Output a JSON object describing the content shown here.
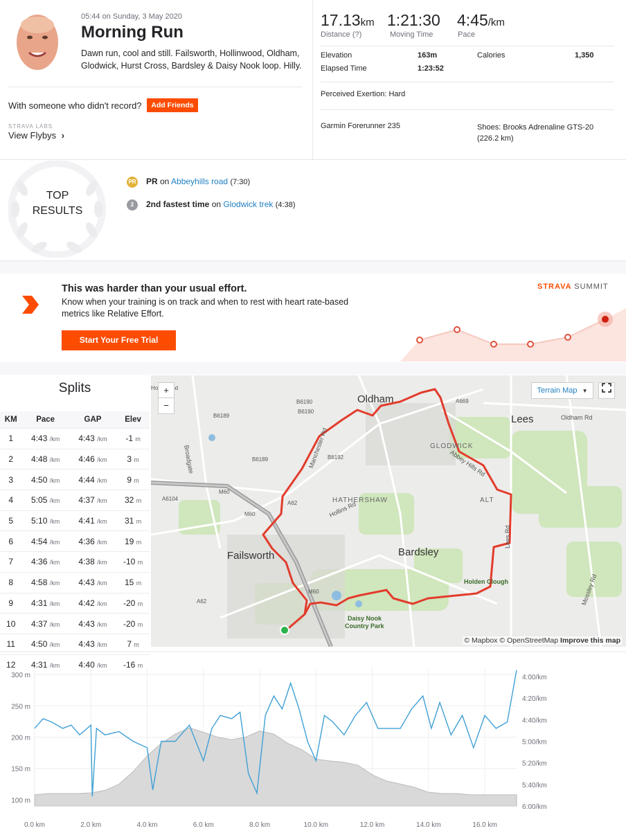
{
  "activity": {
    "datetime": "05:44 on Sunday, 3 May 2020",
    "title": "Morning Run",
    "description": "Dawn run, cool and still. Failsworth, Hollinwood, Oldham, Glodwick, Hurst Cross, Bardsley & Daisy Nook loop. Hilly."
  },
  "social": {
    "with_text": "With someone who didn't record?",
    "add_friends": "Add Friends",
    "labs": "STRAVA LABS",
    "flybys": "View Flybys"
  },
  "stats": {
    "distance": {
      "value": "17.13",
      "unit": "km",
      "label": "Distance (?)"
    },
    "moving_time": {
      "value": "1:21:30",
      "label": "Moving Time"
    },
    "pace": {
      "value": "4:45",
      "unit": "/km",
      "label": "Pace"
    },
    "elevation": {
      "label": "Elevation",
      "value": "163m"
    },
    "calories": {
      "label": "Calories",
      "value": "1,350"
    },
    "elapsed": {
      "label": "Elapsed Time",
      "value": "1:23:52"
    },
    "exertion_label": "Perceived Exertion:",
    "exertion_value": "Hard",
    "device": "Garmin Forerunner 235",
    "shoes": "Shoes: Brooks Adrenaline GTS-20 (226.2 km)"
  },
  "top_results": {
    "label_line1": "TOP",
    "label_line2": "RESULTS",
    "items": [
      {
        "badge": "PR",
        "bold": "PR",
        "mid": " on ",
        "segment": "Abbeyhills road",
        "time": "(7:30)"
      },
      {
        "badge": "2",
        "bold": "2nd fastest time",
        "mid": " on ",
        "segment": "Glodwick trek",
        "time": "(4:38)"
      }
    ]
  },
  "summit": {
    "heading": "This was harder than your usual effort.",
    "body": "Know when your training is on track and when to rest with heart rate-based metrics like Relative Effort.",
    "button": "Start Your Free Trial",
    "logo_strava": "STRAVA",
    "logo_summit": "SUMMIT"
  },
  "splits": {
    "title": "Splits",
    "headers": [
      "KM",
      "Pace",
      "GAP",
      "Elev"
    ],
    "pace_unit": "/km",
    "elev_unit": "m",
    "rows": [
      [
        "1",
        "4:43",
        "4:43",
        "-1"
      ],
      [
        "2",
        "4:48",
        "4:46",
        "3"
      ],
      [
        "3",
        "4:50",
        "4:44",
        "9"
      ],
      [
        "4",
        "5:05",
        "4:37",
        "32"
      ],
      [
        "5",
        "5:10",
        "4:41",
        "31"
      ],
      [
        "6",
        "4:54",
        "4:36",
        "19"
      ],
      [
        "7",
        "4:36",
        "4:38",
        "-10"
      ],
      [
        "8",
        "4:58",
        "4:43",
        "15"
      ],
      [
        "9",
        "4:31",
        "4:42",
        "-20"
      ],
      [
        "10",
        "4:37",
        "4:43",
        "-20"
      ],
      [
        "11",
        "4:50",
        "4:43",
        "7"
      ],
      [
        "12",
        "4:31",
        "4:40",
        "-16"
      ]
    ]
  },
  "map": {
    "type_label": "Terrain Map",
    "zoom_in": "+",
    "zoom_out": "−",
    "attribution": "© Mapbox © OpenStreetMap",
    "improve": "Improve this map",
    "places": {
      "oldham": "Oldham",
      "lees": "Lees",
      "failsworth": "Failsworth",
      "bardsley": "Bardsley",
      "hathershaw": "HATHERSHAW",
      "glodwick": "GLODWICK",
      "alt": "ALT",
      "holden": "Holden Clough",
      "daisy1": "Daisy Nook",
      "daisy2": "Country Park",
      "road_b6190": "B6190",
      "road_b6190b": "B6190",
      "road_b6189": "B6189",
      "road_b6189b": "B6189",
      "road_b6192": "B6192",
      "road_a669": "A669",
      "road_a6104": "A6104",
      "road_m60": "M60",
      "road_m60b": "M60",
      "road_m60c": "M60",
      "road_a62": "A62",
      "road_a62b": "A62",
      "road_manchester": "Manchester Rd",
      "road_hollins": "Hollins Rd",
      "road_abbey": "Abbey Hills Rd",
      "road_lees": "Lees Rd",
      "road_oldham": "Oldham Rd",
      "road_mossley": "Mossley Rd",
      "road_broadgate": "Broadgate",
      "road_hollinwood": "Hollinwood"
    }
  },
  "chart_data": {
    "type": "line",
    "x_label_ticks": [
      "0.0 km",
      "2.0 km",
      "4.0 km",
      "6.0 km",
      "8.0 km",
      "10.0 km",
      "12.0 km",
      "14.0 km",
      "16.0 km"
    ],
    "xlim": [
      0,
      17.13
    ],
    "left_axis": {
      "ticks": [
        "100 m",
        "150 m",
        "200 m",
        "250 m",
        "300 m"
      ],
      "ylim": [
        90,
        310
      ]
    },
    "right_axis": {
      "ticks": [
        "4:00/km",
        "4:20/km",
        "4:40/km",
        "5:00/km",
        "5:20/km",
        "5:40/km",
        "6:00/km"
      ],
      "ylim_min_per_km": [
        4.0,
        6.0
      ]
    },
    "series": [
      {
        "kind": "elevation",
        "color": "#c8c8c8",
        "x": [
          0,
          0.5,
          1,
          1.5,
          2,
          2.5,
          3,
          3.5,
          4,
          4.5,
          5,
          5.5,
          6,
          6.5,
          7,
          7.5,
          8,
          8.5,
          9,
          9.5,
          10,
          10.5,
          11,
          11.5,
          12,
          12.5,
          13,
          13.5,
          14,
          14.5,
          15,
          15.5,
          16,
          16.5,
          17.13
        ],
        "values": [
          108,
          110,
          110,
          110,
          111,
          115,
          125,
          145,
          170,
          190,
          205,
          215,
          208,
          200,
          196,
          200,
          210,
          205,
          190,
          180,
          165,
          162,
          160,
          155,
          140,
          130,
          125,
          120,
          112,
          110,
          110,
          108,
          108,
          108,
          108
        ]
      },
      {
        "kind": "pace",
        "color": "#3fa0d6",
        "x": [
          0,
          0.3,
          0.6,
          1,
          1.3,
          1.6,
          2,
          2.05,
          2.2,
          2.5,
          3,
          3.5,
          4,
          4.2,
          4.5,
          5,
          5.5,
          6,
          6.3,
          6.6,
          7,
          7.3,
          7.6,
          7.9,
          8.2,
          8.5,
          8.8,
          9.1,
          9.4,
          9.7,
          10,
          10.3,
          10.6,
          11,
          11.4,
          11.8,
          12.2,
          12.6,
          13,
          13.4,
          13.8,
          14.1,
          14.4,
          14.8,
          15.2,
          15.6,
          16,
          16.4,
          16.8,
          17.13
        ],
        "values_min_per_km": [
          4.8,
          4.65,
          4.7,
          4.8,
          4.75,
          4.9,
          4.75,
          5.85,
          4.8,
          4.9,
          4.85,
          5.0,
          5.1,
          5.75,
          5.0,
          5.0,
          4.75,
          5.3,
          4.8,
          4.6,
          4.65,
          4.55,
          5.5,
          5.8,
          4.6,
          4.3,
          4.5,
          4.1,
          4.5,
          5.0,
          5.3,
          4.6,
          4.7,
          4.9,
          4.6,
          4.4,
          4.8,
          4.8,
          4.8,
          4.5,
          4.3,
          4.8,
          4.4,
          4.9,
          4.6,
          5.1,
          4.6,
          4.8,
          4.7,
          3.9
        ]
      }
    ]
  }
}
